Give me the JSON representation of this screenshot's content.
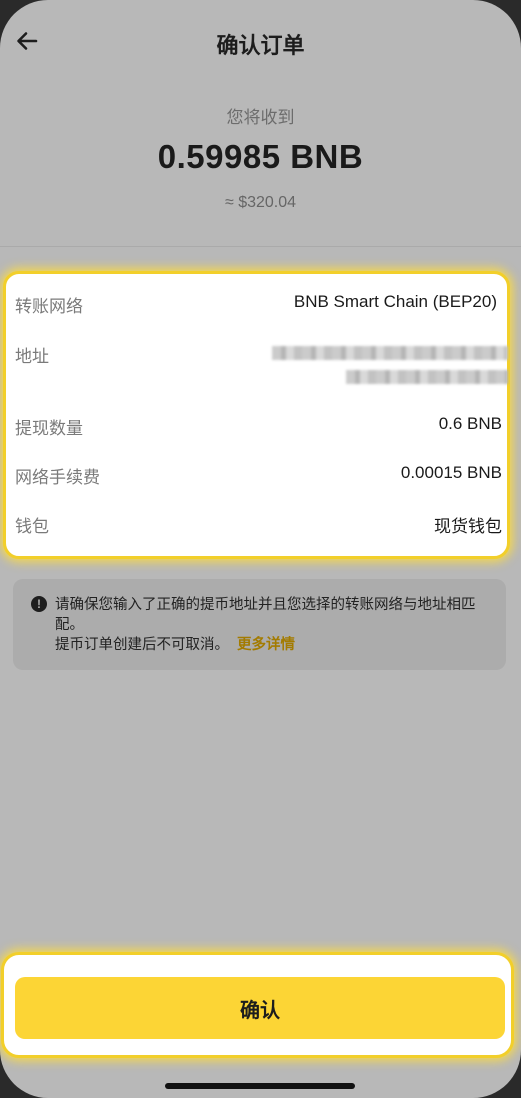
{
  "header": {
    "title": "确认订单"
  },
  "summary": {
    "receive_label": "您将收到",
    "amount": "0.59985 BNB",
    "usd_value": "≈ $320.04"
  },
  "details": {
    "network": {
      "label": "转账网络",
      "value": "BNB Smart Chain (BEP20)"
    },
    "address": {
      "label": "地址"
    },
    "withdraw_amount": {
      "label": "提现数量",
      "value": "0.6 BNB"
    },
    "network_fee": {
      "label": "网络手续费",
      "value": "0.00015 BNB"
    },
    "wallet": {
      "label": "钱包",
      "value": "现货钱包"
    }
  },
  "warning": {
    "text_line1": "请确保您输入了正确的提币地址并且您选择的转账网络与地址相匹配。",
    "text_line2": "提币订单创建后不可取消。",
    "link": "更多详情"
  },
  "footer": {
    "confirm_label": "确认"
  },
  "colors": {
    "accent": "#fcd535",
    "highlight": "#f2cf2a",
    "link": "#a37b00"
  },
  "icons": {
    "back": "arrow-left-icon",
    "warning": "exclamation-circle-icon"
  }
}
